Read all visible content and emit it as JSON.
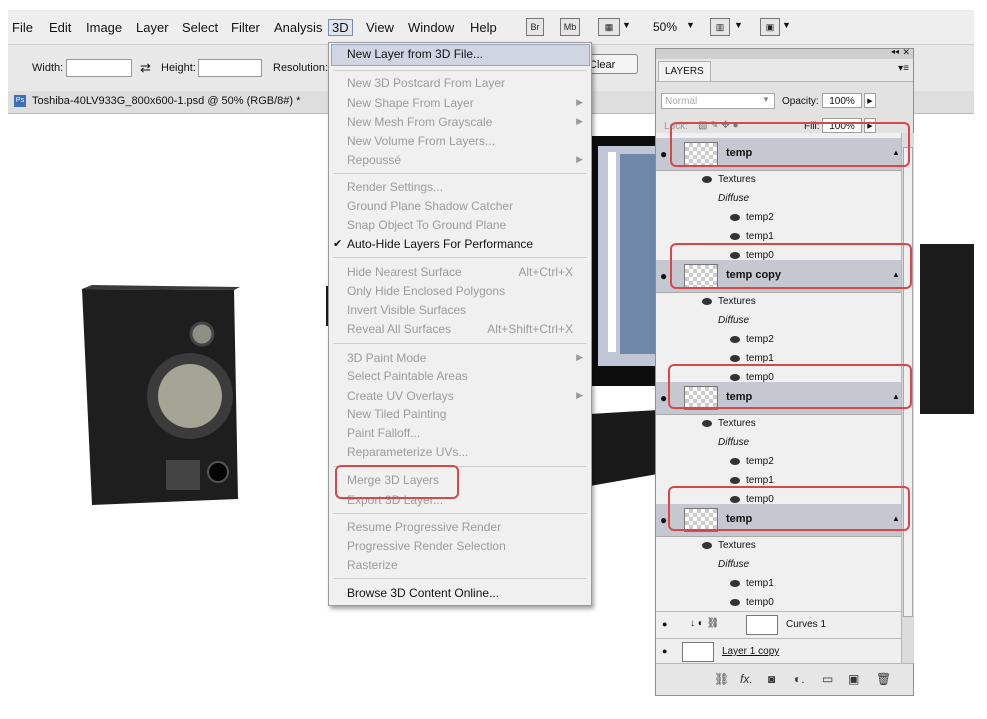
{
  "menubar": {
    "items": [
      "File",
      "Edit",
      "Image",
      "Layer",
      "Select",
      "Filter",
      "Analysis",
      "3D",
      "View",
      "Window",
      "Help"
    ],
    "bridge_label": "Br",
    "minibridge_label": "Mb",
    "zoom": "50%"
  },
  "options": {
    "width_label": "Width:",
    "height_label": "Height:",
    "resolution_label": "Resolution:",
    "clear_label": "Clear"
  },
  "document": {
    "tab_title": "Toshiba-40LV933G_800x600-1.psd @ 50% (RGB/8#) *"
  },
  "menu3d": {
    "new_layer": "New Layer from 3D File...",
    "postcard": "New 3D Postcard From Layer",
    "shape": "New Shape From Layer",
    "mesh": "New Mesh From Grayscale",
    "volume": "New Volume From Layers...",
    "repousse": "Repoussé",
    "render_settings": "Render Settings...",
    "ground_shadow": "Ground Plane Shadow Catcher",
    "snap_ground": "Snap Object To Ground Plane",
    "autohide": "Auto-Hide Layers For Performance",
    "hide_surface": "Hide Nearest Surface",
    "hide_surface_sc": "Alt+Ctrl+X",
    "only_hide": "Only Hide Enclosed Polygons",
    "invert": "Invert Visible Surfaces",
    "reveal": "Reveal All Surfaces",
    "reveal_sc": "Alt+Shift+Ctrl+X",
    "paint_mode": "3D Paint Mode",
    "paintable": "Select Paintable Areas",
    "uv_overlays": "Create UV Overlays",
    "tiled": "New Tiled Painting",
    "falloff": "Paint Falloff...",
    "reparam": "Reparameterize UVs...",
    "merge": "Merge 3D Layers",
    "export": "Export 3D Layer...",
    "resume": "Resume Progressive Render",
    "prog_sel": "Progressive Render Selection",
    "rasterize": "Rasterize",
    "browse": "Browse 3D Content Online..."
  },
  "layers": {
    "tab": "LAYERS",
    "blend_mode": "Normal",
    "opacity_label": "Opacity:",
    "opacity": "100%",
    "lock_label": "Lock:",
    "fill_label": "Fill:",
    "fill": "100%",
    "textures": "Textures",
    "diffuse": "Diffuse",
    "groups": [
      {
        "name": "temp",
        "subs": [
          "temp2",
          "temp1",
          "temp0"
        ]
      },
      {
        "name": "temp copy",
        "subs": [
          "temp2",
          "temp1",
          "temp0"
        ]
      },
      {
        "name": "temp",
        "subs": [
          "temp2",
          "temp1",
          "temp0"
        ]
      },
      {
        "name": "temp",
        "subs": [
          "temp1",
          "temp0"
        ]
      }
    ],
    "curves": "Curves 1",
    "layer1copy": "Layer 1 copy"
  }
}
